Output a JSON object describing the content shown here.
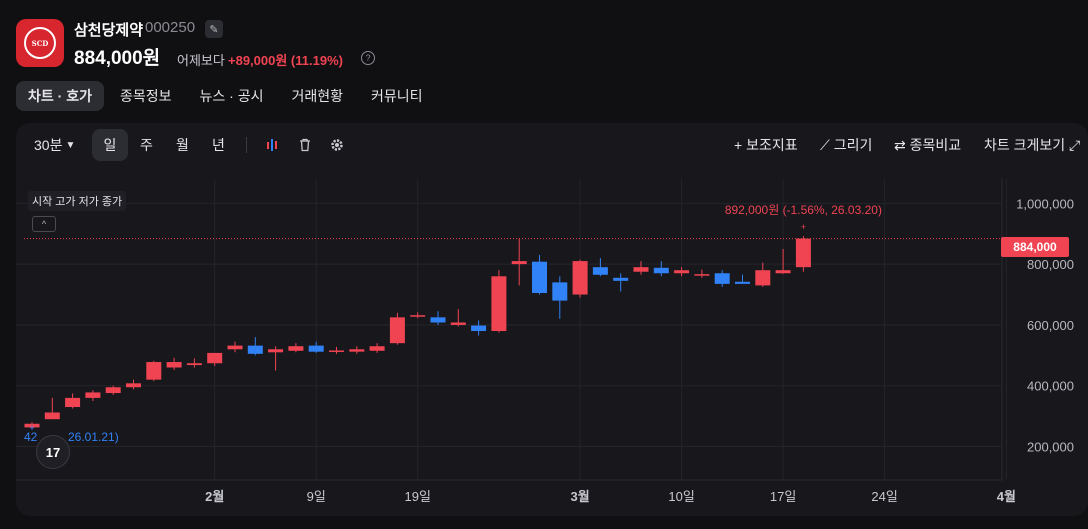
{
  "header": {
    "logo_text": "SCD",
    "name": "삼천당제약",
    "code": "000250",
    "price": "884,000원",
    "vs_label": "어제보다",
    "change": "+89,000원 (11.19%)",
    "help": "?"
  },
  "tabs": [
    {
      "label": "차트 · 호가",
      "active": true
    },
    {
      "label": "종목정보",
      "active": false
    },
    {
      "label": "뉴스 · 공시",
      "active": false
    },
    {
      "label": "거래현황",
      "active": false
    },
    {
      "label": "커뮤니티",
      "active": false
    }
  ],
  "toolbar": {
    "interval": "30분",
    "periods": [
      "일",
      "주",
      "월",
      "년"
    ],
    "selected_period": "일",
    "indicator": "+ 보조지표",
    "draw": "⟋ 그리기",
    "compare": "⇄ 종목비교",
    "enlarge": "차트 크게보기 ⤢"
  },
  "legend": {
    "ohlc": "시작 고가 저가 종가",
    "collapse": "^"
  },
  "tv_logo": "17",
  "colors": {
    "up": "#f04452",
    "down": "#3182f6",
    "bg": "#17171c",
    "grid": "#24242b"
  },
  "chart_data": {
    "type": "candlestick",
    "y_ticks": [
      200000,
      400000,
      600000,
      800000,
      1000000
    ],
    "y_tick_labels": [
      "200,000",
      "400,000",
      "600,000",
      "800,000",
      "1,000,000"
    ],
    "ylim": [
      90000,
      1080000
    ],
    "x_ticks": [
      {
        "index": 9,
        "label": "2월"
      },
      {
        "index": 14,
        "label": "9일"
      },
      {
        "index": 19,
        "label": "19일"
      },
      {
        "index": 27,
        "label": "3월"
      },
      {
        "index": 32,
        "label": "10일"
      },
      {
        "index": 37,
        "label": "17일"
      },
      {
        "index": 42,
        "label": "24일"
      },
      {
        "index": 48,
        "label": "4월"
      }
    ],
    "current_price": 884000,
    "current_price_label": "884,000",
    "max_annotation": "892,000원 (-1.56%, 26.03.20)",
    "min_annotation": "42",
    "min_annotation_date": "26.01.21)",
    "candles": [
      {
        "o": 263000,
        "h": 280000,
        "l": 258000,
        "c": 275000
      },
      {
        "o": 290000,
        "h": 360000,
        "l": 290000,
        "c": 312000
      },
      {
        "o": 330000,
        "h": 375000,
        "l": 325000,
        "c": 360000
      },
      {
        "o": 360000,
        "h": 385000,
        "l": 350000,
        "c": 378000
      },
      {
        "o": 376000,
        "h": 400000,
        "l": 370000,
        "c": 395000
      },
      {
        "o": 395000,
        "h": 420000,
        "l": 388000,
        "c": 408000
      },
      {
        "o": 420000,
        "h": 482000,
        "l": 415000,
        "c": 478000
      },
      {
        "o": 460000,
        "h": 492000,
        "l": 452000,
        "c": 478000
      },
      {
        "o": 468000,
        "h": 490000,
        "l": 460000,
        "c": 474000
      },
      {
        "o": 474000,
        "h": 500000,
        "l": 465000,
        "c": 508000
      },
      {
        "o": 520000,
        "h": 545000,
        "l": 510000,
        "c": 532000
      },
      {
        "o": 532000,
        "h": 560000,
        "l": 500000,
        "c": 505000
      },
      {
        "o": 510000,
        "h": 530000,
        "l": 450000,
        "c": 520000
      },
      {
        "o": 515000,
        "h": 540000,
        "l": 510000,
        "c": 530000
      },
      {
        "o": 532000,
        "h": 545000,
        "l": 508000,
        "c": 512000
      },
      {
        "o": 514000,
        "h": 528000,
        "l": 505000,
        "c": 516000
      },
      {
        "o": 512000,
        "h": 530000,
        "l": 505000,
        "c": 520000
      },
      {
        "o": 515000,
        "h": 540000,
        "l": 508000,
        "c": 530000
      },
      {
        "o": 540000,
        "h": 640000,
        "l": 535000,
        "c": 625000
      },
      {
        "o": 628000,
        "h": 642000,
        "l": 622000,
        "c": 632000
      },
      {
        "o": 625000,
        "h": 645000,
        "l": 600000,
        "c": 608000
      },
      {
        "o": 600000,
        "h": 652000,
        "l": 595000,
        "c": 608000
      },
      {
        "o": 598000,
        "h": 615000,
        "l": 565000,
        "c": 580000
      },
      {
        "o": 580000,
        "h": 780000,
        "l": 575000,
        "c": 760000
      },
      {
        "o": 800000,
        "h": 885000,
        "l": 730000,
        "c": 810000
      },
      {
        "o": 808000,
        "h": 830000,
        "l": 700000,
        "c": 705000
      },
      {
        "o": 740000,
        "h": 760000,
        "l": 620000,
        "c": 680000
      },
      {
        "o": 700000,
        "h": 815000,
        "l": 690000,
        "c": 810000
      },
      {
        "o": 790000,
        "h": 820000,
        "l": 760000,
        "c": 765000
      },
      {
        "o": 755000,
        "h": 770000,
        "l": 710000,
        "c": 745000
      },
      {
        "o": 775000,
        "h": 810000,
        "l": 765000,
        "c": 790000
      },
      {
        "o": 788000,
        "h": 810000,
        "l": 760000,
        "c": 770000
      },
      {
        "o": 770000,
        "h": 790000,
        "l": 760000,
        "c": 780000
      },
      {
        "o": 762000,
        "h": 782000,
        "l": 755000,
        "c": 767000
      },
      {
        "o": 770000,
        "h": 780000,
        "l": 725000,
        "c": 735000
      },
      {
        "o": 742000,
        "h": 765000,
        "l": 735000,
        "c": 735000
      },
      {
        "o": 730000,
        "h": 805000,
        "l": 725000,
        "c": 780000
      },
      {
        "o": 770000,
        "h": 850000,
        "l": 768000,
        "c": 780000
      },
      {
        "o": 790000,
        "h": 892000,
        "l": 775000,
        "c": 884000
      }
    ],
    "candle_slots": [
      0,
      1,
      2,
      3,
      4,
      5,
      6,
      7,
      8,
      9,
      10,
      11,
      12,
      13,
      14,
      15,
      16,
      17,
      18,
      19,
      20,
      21,
      22,
      23,
      24,
      25,
      26,
      27,
      28,
      29,
      30,
      31,
      32,
      33,
      34,
      35,
      36,
      37,
      38
    ]
  }
}
